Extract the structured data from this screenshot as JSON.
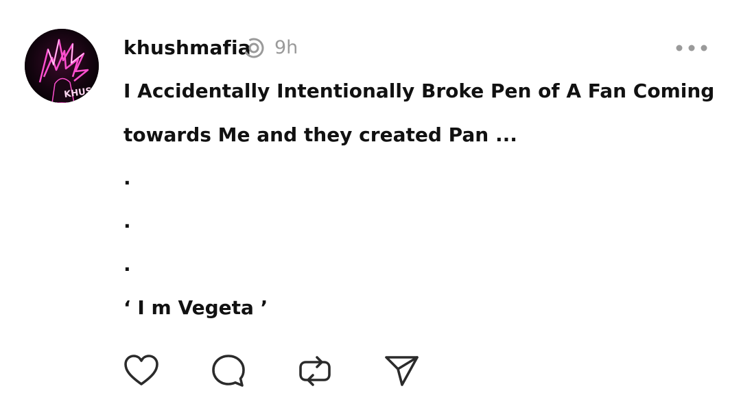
{
  "post": {
    "author": "khushmafia",
    "time": "9h",
    "avatar_label": "KHUSH",
    "lines": [
      "I Accidentally Intentionally Broke Pen of A Fan Coming",
      "towards Me and they created Pan ...",
      ".",
      ".",
      ".",
      "‘ I m Vegeta ’"
    ]
  },
  "icons": {
    "thread": "thread-activity-icon",
    "more": "more-options-icon",
    "like": "heart-icon",
    "comment": "comment-icon",
    "repost": "repost-icon",
    "share": "send-icon"
  },
  "colors": {
    "text": "#111111",
    "muted": "#9a9a9a",
    "icon": "#2b2b2b",
    "avatar_glow": "#ff3fbf"
  }
}
